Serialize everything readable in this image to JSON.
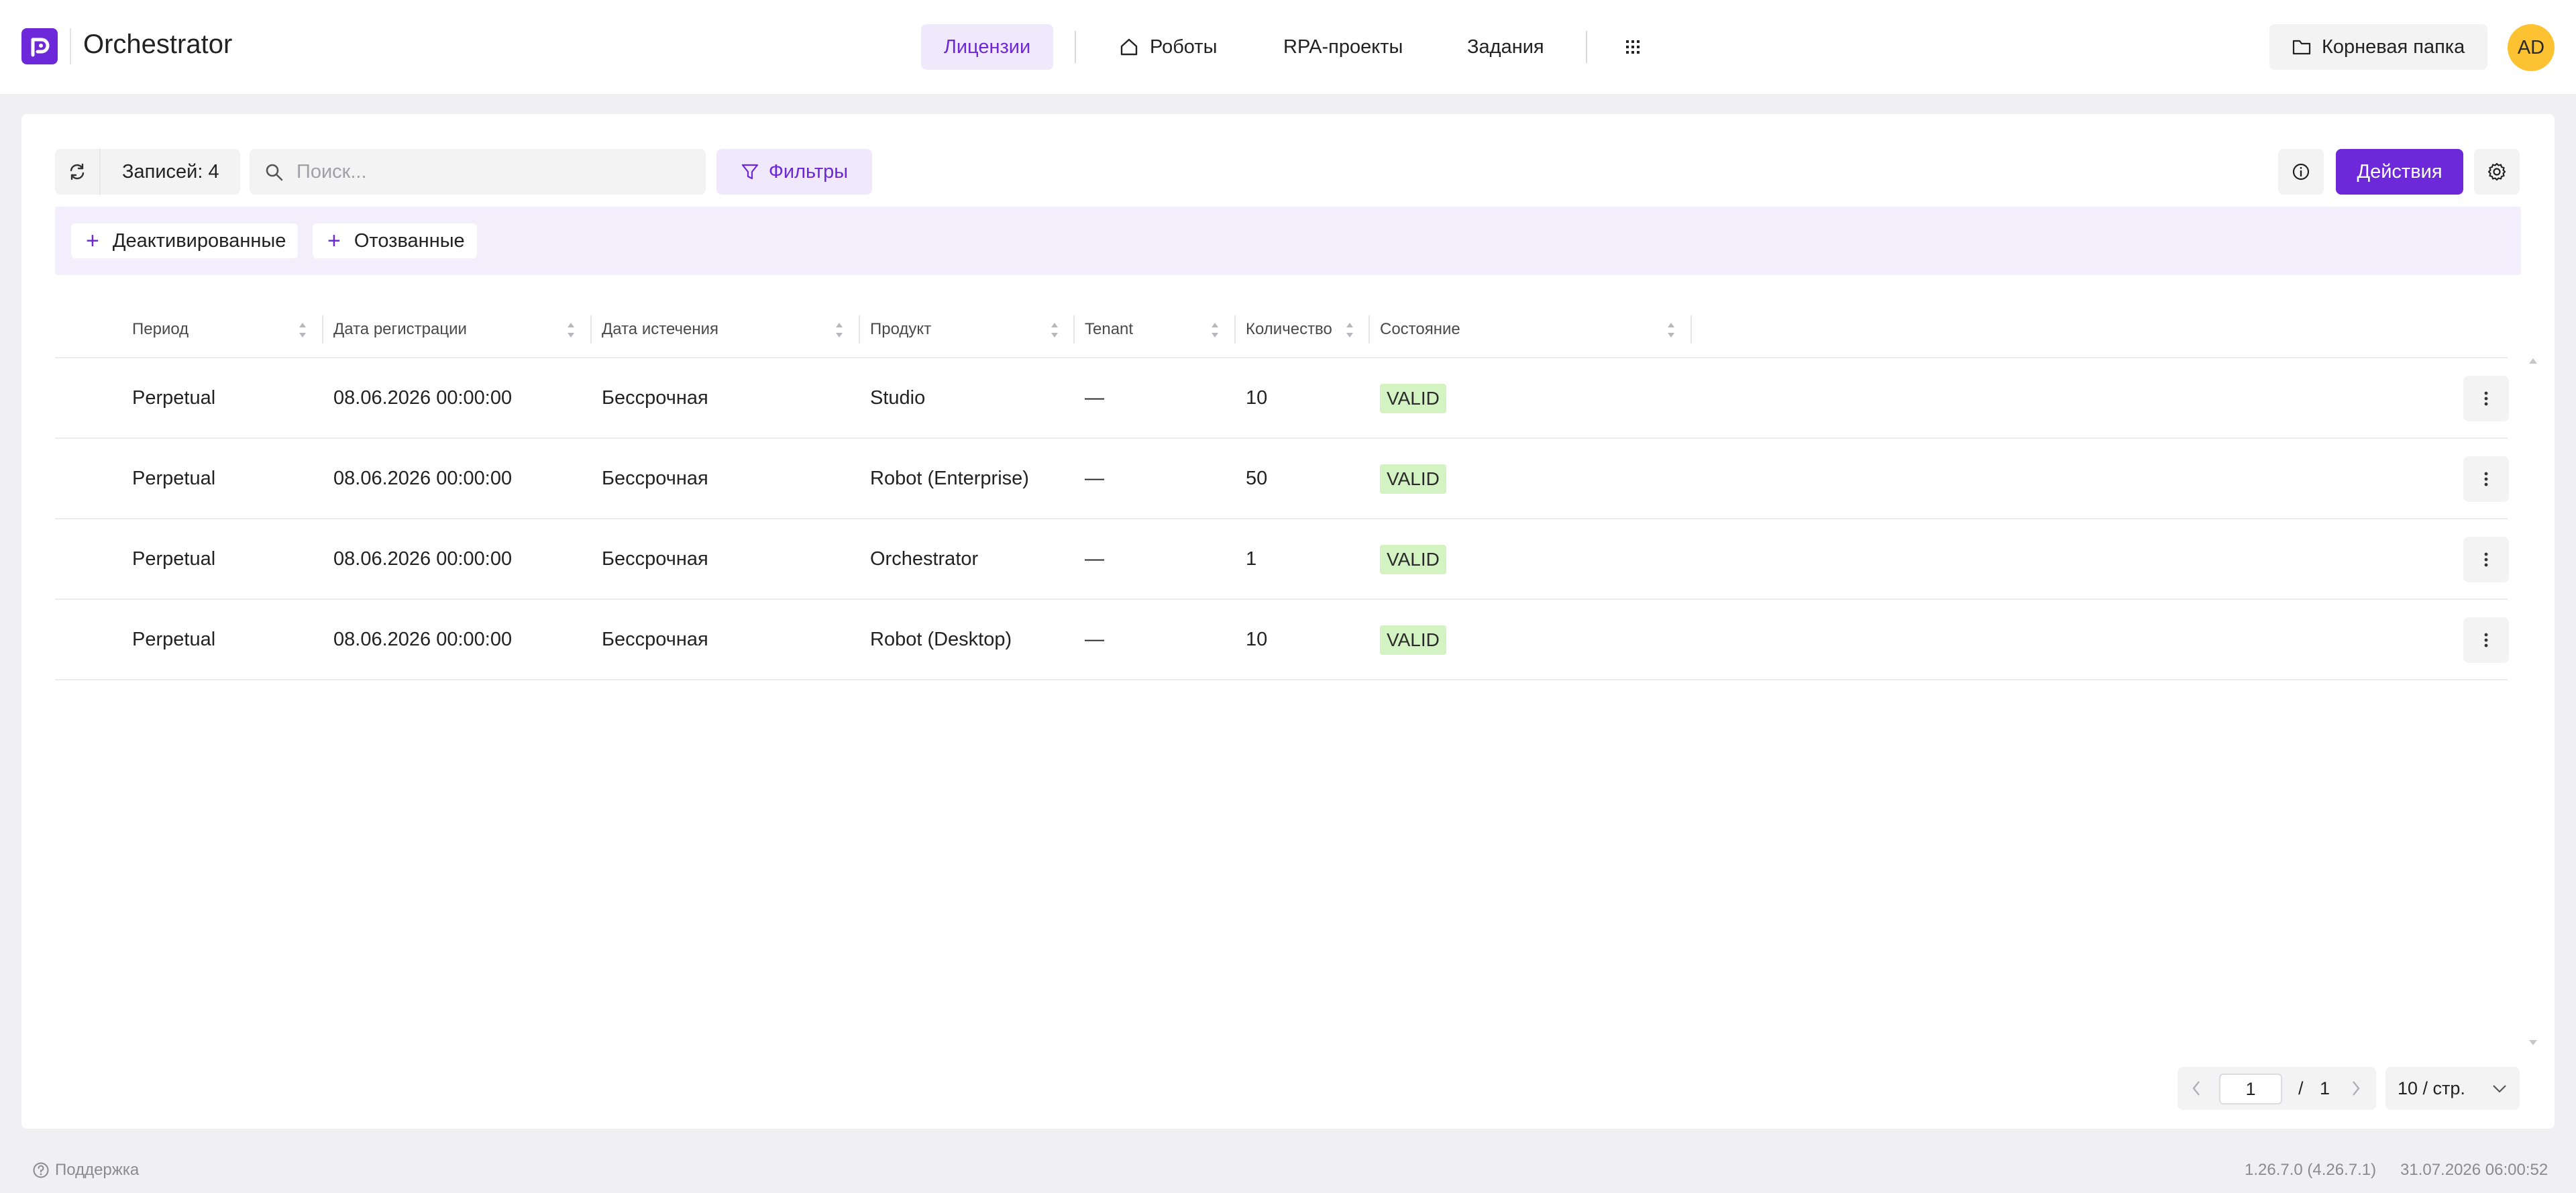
{
  "header": {
    "app_title": "Orchestrator",
    "nav": {
      "licenses": "Лицензии",
      "robots": "Роботы",
      "rpa_projects": "RPA-проекты",
      "tasks": "Задания"
    },
    "folder_button": "Корневая папка",
    "avatar_initials": "AD",
    "colors": {
      "accent": "#6d28d9",
      "avatar": "#fcc232"
    }
  },
  "toolbar": {
    "records_label": "Записей: 4",
    "search_placeholder": "Поиск...",
    "filters_label": "Фильтры",
    "actions_label": "Действия"
  },
  "quick_filters": {
    "deactivated": "Деактивированные",
    "revoked": "Отозванные"
  },
  "table": {
    "columns": {
      "period": "Период",
      "registration_date": "Дата регистрации",
      "expiration_date": "Дата истечения",
      "product": "Продукт",
      "tenant": "Tenant",
      "quantity": "Количество",
      "state": "Состояние"
    },
    "rows": [
      {
        "period": "Perpetual",
        "registration_date": "08.06.2026 00:00:00",
        "expiration_date": "Бессрочная",
        "product": "Studio",
        "tenant": "—",
        "quantity": "10",
        "state": "VALID"
      },
      {
        "period": "Perpetual",
        "registration_date": "08.06.2026 00:00:00",
        "expiration_date": "Бессрочная",
        "product": "Robot (Enterprise)",
        "tenant": "—",
        "quantity": "50",
        "state": "VALID"
      },
      {
        "period": "Perpetual",
        "registration_date": "08.06.2026 00:00:00",
        "expiration_date": "Бессрочная",
        "product": "Orchestrator",
        "tenant": "—",
        "quantity": "1",
        "state": "VALID"
      },
      {
        "period": "Perpetual",
        "registration_date": "08.06.2026 00:00:00",
        "expiration_date": "Бессрочная",
        "product": "Robot (Desktop)",
        "tenant": "—",
        "quantity": "10",
        "state": "VALID"
      }
    ],
    "state_color": "#d4f3c2"
  },
  "pagination": {
    "current_page": "1",
    "separator": "/",
    "total_pages": "1",
    "page_size": "10 / стр."
  },
  "footer": {
    "support": "Поддержка",
    "version": "1.26.7.0 (4.26.7.1)",
    "datetime": "31.07.2026 06:00:52"
  }
}
